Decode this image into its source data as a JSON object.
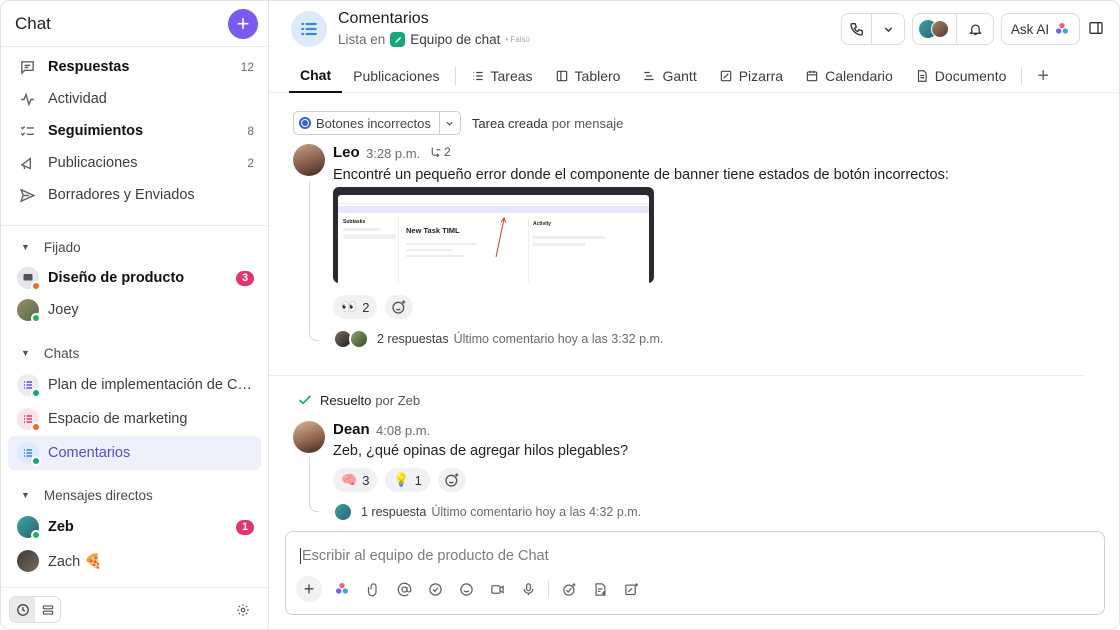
{
  "sidebar": {
    "title": "Chat",
    "nav": [
      {
        "label": "Respuestas",
        "count": "12",
        "icon": "chat-bubble-icon",
        "bold": true
      },
      {
        "label": "Actividad",
        "count": "",
        "icon": "activity-icon",
        "bold": false
      },
      {
        "label": "Seguimientos",
        "count": "8",
        "icon": "checklist-icon",
        "bold": true
      },
      {
        "label": "Publicaciones",
        "count": "2",
        "icon": "megaphone-icon",
        "bold": false
      },
      {
        "label": "Borradores y Enviados",
        "count": "",
        "icon": "send-icon",
        "bold": false
      }
    ],
    "pinned_label": "Fijado",
    "pinned": [
      {
        "label": "Diseño de producto",
        "badge": "3"
      },
      {
        "label": "Joey"
      }
    ],
    "chats_label": "Chats",
    "chats": [
      {
        "label": "Plan de implementación de Ch..."
      },
      {
        "label": "Espacio de marketing"
      },
      {
        "label": "Comentarios"
      }
    ],
    "dm_label": "Mensajes directos",
    "dms": [
      {
        "label": "Zeb",
        "badge": "1"
      },
      {
        "label": "Zach",
        "emoji": "🍕"
      }
    ]
  },
  "header": {
    "title": "Comentarios",
    "sub_prefix": "Lista en",
    "space": "Equipo de chat",
    "tiny": "• Falso",
    "ask_ai": "Ask AI",
    "tabs": [
      "Chat",
      "Publicaciones",
      "Tareas",
      "Tablero",
      "Gantt",
      "Pizarra",
      "Calendario",
      "Documento"
    ]
  },
  "feed": {
    "task_tag": "Botones incorrectos",
    "task_created": "Tarea creada",
    "task_by": "por mensaje",
    "msg1": {
      "author": "Leo",
      "time": "3:28 p.m.",
      "extra": "2",
      "text": "Encontré un pequeño error donde el componente de banner tiene estados de botón incorrectos:",
      "react_emoji": "👀",
      "react_count": "2",
      "replies": "2 respuestas",
      "last": "Último comentario hoy a las 3:32 p.m."
    },
    "screenshot": {
      "panel_title": "Subtasks",
      "task_title": "New Task TIML",
      "activity": "Activity"
    },
    "resolved": "Resuelto",
    "resolved_by": "por Zeb",
    "msg2": {
      "author": "Dean",
      "time": "4:08 p.m.",
      "text": "Zeb, ¿qué opinas de agregar hilos plegables?",
      "r1_emoji": "🧠",
      "r1_count": "3",
      "r2_emoji": "💡",
      "r2_count": "1",
      "replies": "1 respuesta",
      "last": "Último comentario hoy a las 4:32 p.m."
    }
  },
  "composer": {
    "placeholder": "Escribir al equipo de producto de Chat"
  },
  "colors": {
    "accent": "#7b5af0",
    "badge": "#e0356f",
    "active_bg": "#eef0fb",
    "active_text": "#5b47d6"
  }
}
